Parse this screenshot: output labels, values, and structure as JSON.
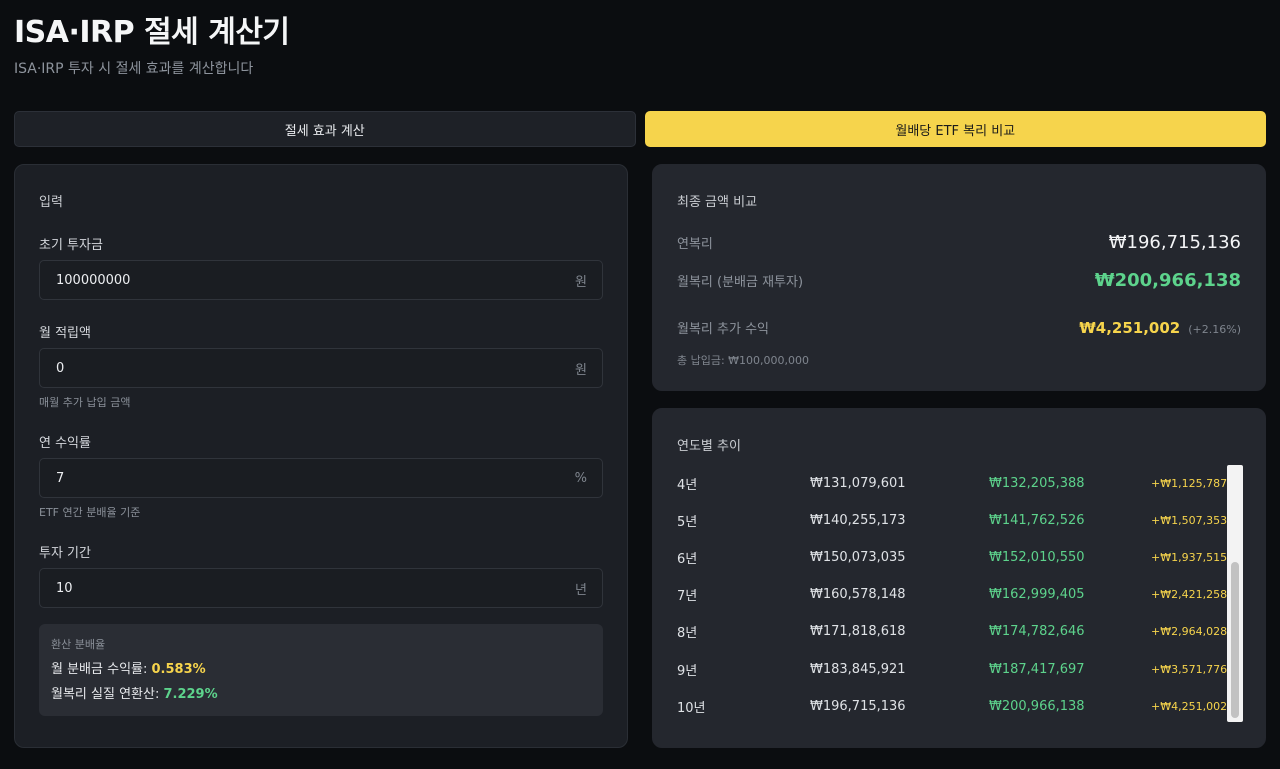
{
  "header": {
    "title": "ISA·IRP 절세 계산기",
    "subtitle": "ISA·IRP 투자 시 절세 효과를 계산합니다"
  },
  "tabs": [
    {
      "label": "절세 효과 계산",
      "active": false
    },
    {
      "label": "월배당 ETF 복리 비교",
      "active": true
    }
  ],
  "input_panel": {
    "heading": "입력",
    "initial": {
      "label": "초기 투자금",
      "value": "100000000",
      "unit": "원"
    },
    "monthly": {
      "label": "월 적립액",
      "value": "0",
      "unit": "원",
      "hint": "매월 추가 납입 금액"
    },
    "rate": {
      "label": "연 수익률",
      "value": "7",
      "unit": "%",
      "hint": "ETF 연간 분배율 기준"
    },
    "period": {
      "label": "투자 기간",
      "value": "10",
      "unit": "년"
    },
    "conversion": {
      "title": "환산 분배율",
      "monthly_label": "월 분배금 수익률:",
      "monthly_value": "0.583%",
      "effective_label": "월복리 실질 연환산:",
      "effective_value": "7.229%"
    }
  },
  "compare_panel": {
    "heading": "최종 금액 비교",
    "annual_label": "연복리",
    "annual_value": "₩196,715,136",
    "monthly_label": "월복리 (분배금 재투자)",
    "monthly_value": "₩200,966,138",
    "extra_label": "월복리 추가 수익",
    "extra_value": "₩4,251,002",
    "extra_pct": "(+2.16%)",
    "total_paid": "총 납입금: ₩100,000,000"
  },
  "yearly_panel": {
    "heading": "연도별 추이",
    "rows": [
      {
        "year": "4년",
        "annual": "₩131,079,601",
        "monthly": "₩132,205,388",
        "diff": "+₩1,125,787"
      },
      {
        "year": "5년",
        "annual": "₩140,255,173",
        "monthly": "₩141,762,526",
        "diff": "+₩1,507,353"
      },
      {
        "year": "6년",
        "annual": "₩150,073,035",
        "monthly": "₩152,010,550",
        "diff": "+₩1,937,515"
      },
      {
        "year": "7년",
        "annual": "₩160,578,148",
        "monthly": "₩162,999,405",
        "diff": "+₩2,421,258"
      },
      {
        "year": "8년",
        "annual": "₩171,818,618",
        "monthly": "₩174,782,646",
        "diff": "+₩2,964,028"
      },
      {
        "year": "9년",
        "annual": "₩183,845,921",
        "monthly": "₩187,417,697",
        "diff": "+₩3,571,776"
      },
      {
        "year": "10년",
        "annual": "₩196,715,136",
        "monthly": "₩200,966,138",
        "diff": "+₩4,251,002"
      }
    ]
  },
  "colors": {
    "accent_yellow": "#f6d44c",
    "accent_green": "#5dd38c",
    "background": "#0b0d10",
    "panel": "#1c1f25"
  }
}
